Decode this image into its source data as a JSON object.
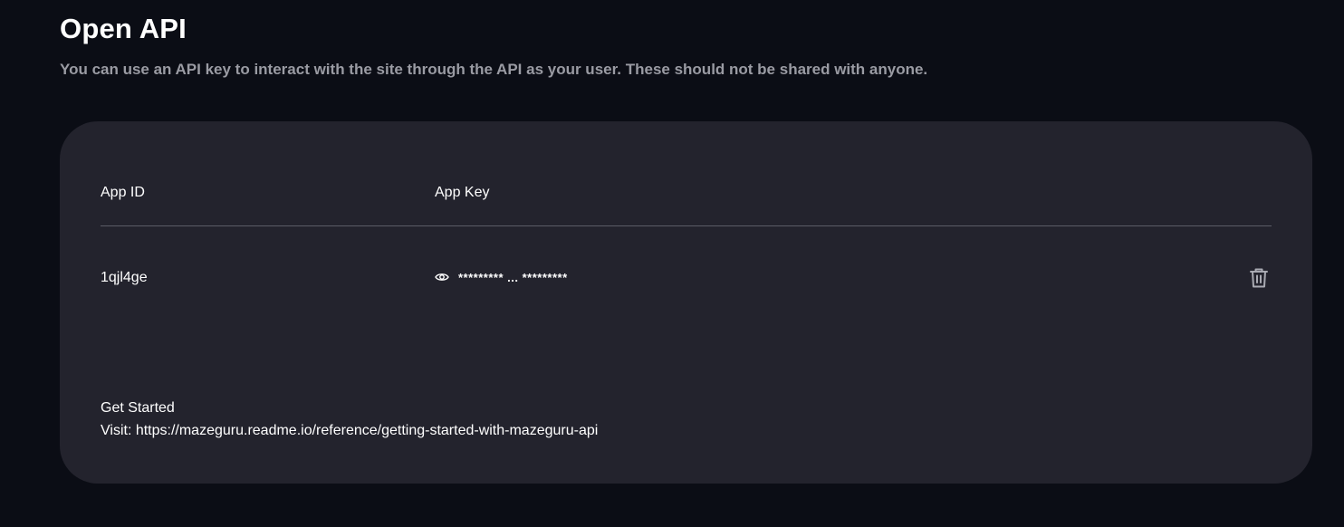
{
  "header": {
    "title": "Open API",
    "subtitle": "You can use an API key to interact with the site through the API as your user. These should not be shared with anyone."
  },
  "table": {
    "columns": [
      "App ID",
      "App Key"
    ],
    "rows": [
      {
        "app_id": "1qjl4ge",
        "app_key_masked": "********* ... *********",
        "reveal_icon": "eye-icon",
        "delete_icon": "trash-icon"
      }
    ]
  },
  "get_started": {
    "title": "Get Started",
    "visit_label": "Visit: ",
    "url": "https://mazeguru.readme.io/reference/getting-started-with-mazeguru-api"
  },
  "colors": {
    "background": "#0b0d15",
    "card": "#23232d",
    "subtitle": "#9a9ba3",
    "divider": "#5b5c66",
    "icon": "#a9aab2"
  }
}
